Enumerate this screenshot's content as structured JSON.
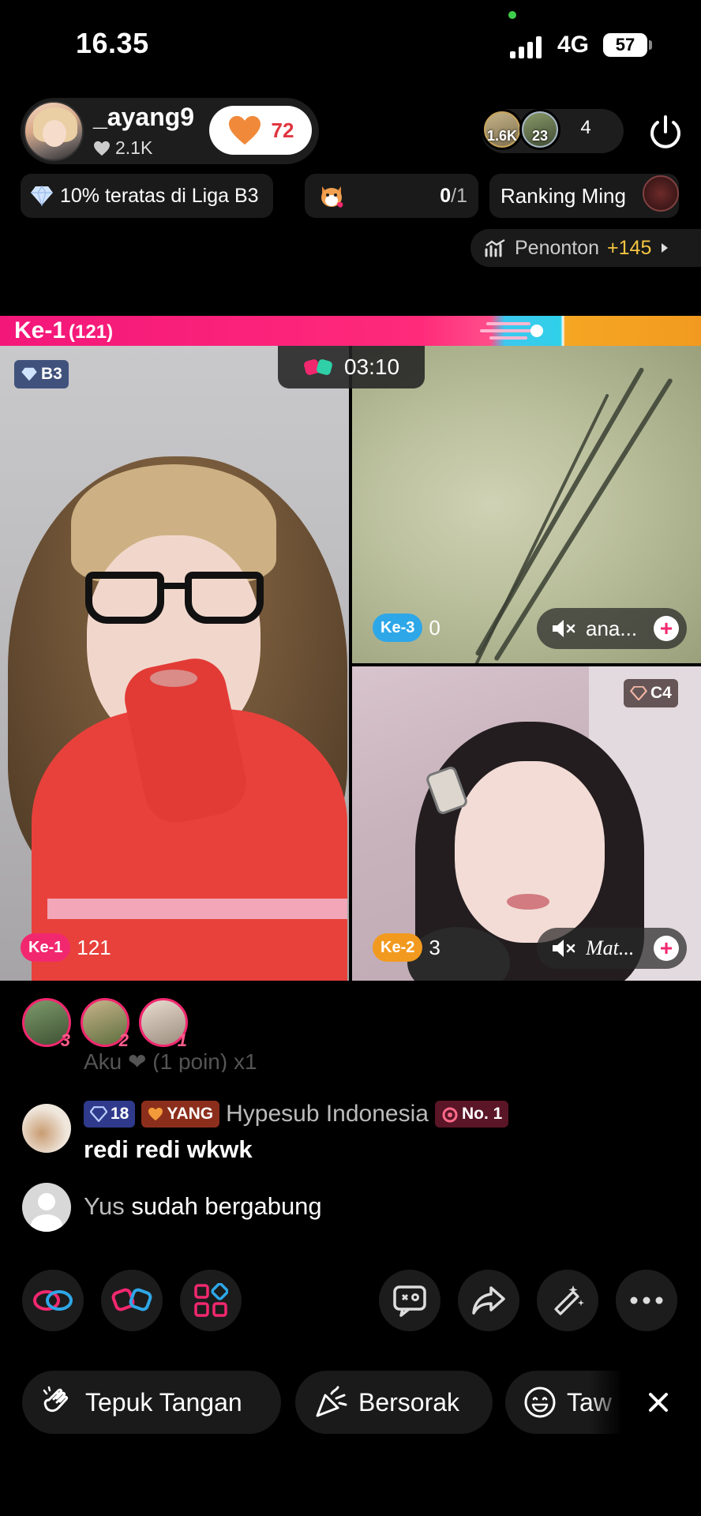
{
  "status": {
    "time": "16.35",
    "network": "4G",
    "battery": "57"
  },
  "host": {
    "name": "_ayang9",
    "likes": "2.1K",
    "follow_count": "72"
  },
  "viewers": {
    "avatar1_label": "1.6K",
    "avatar2_label": "23",
    "count": "4"
  },
  "league": {
    "text": "10% teratas di Liga B3"
  },
  "gift_goal": {
    "current": "0",
    "total": "/1"
  },
  "ranking": {
    "label": "Ranking Ming"
  },
  "penonton": {
    "label": "Penonton",
    "delta": "+145"
  },
  "battle": {
    "rank_label": "Ke-1",
    "score": "(121)",
    "timer": "03:10"
  },
  "panels": {
    "p1": {
      "tier": "B3",
      "rank": "Ke-1",
      "score": "121"
    },
    "p2": {
      "rank": "Ke-3",
      "score": "0",
      "name": "ana..."
    },
    "p3": {
      "tier": "C4",
      "rank": "Ke-2",
      "score": "3",
      "name": "Mat..."
    }
  },
  "supporters": [
    "3",
    "2",
    "1"
  ],
  "chat": {
    "faded": "Aku ❤ (1 poin) x1",
    "message": {
      "level": "18",
      "fan_badge": "YANG",
      "user": "Hypesub Indonesia",
      "rank_badge": "No. 1",
      "text": "redi redi wkwk"
    },
    "join": {
      "user": "Yus",
      "text": "sudah bergabung"
    }
  },
  "reactions": [
    "Tepuk Tangan",
    "Bersorak",
    "Taw"
  ],
  "colors": {
    "accent": "#f2286f",
    "gold": "#f5c542",
    "blue": "#2ea7e8",
    "orange": "#f29a1f"
  }
}
